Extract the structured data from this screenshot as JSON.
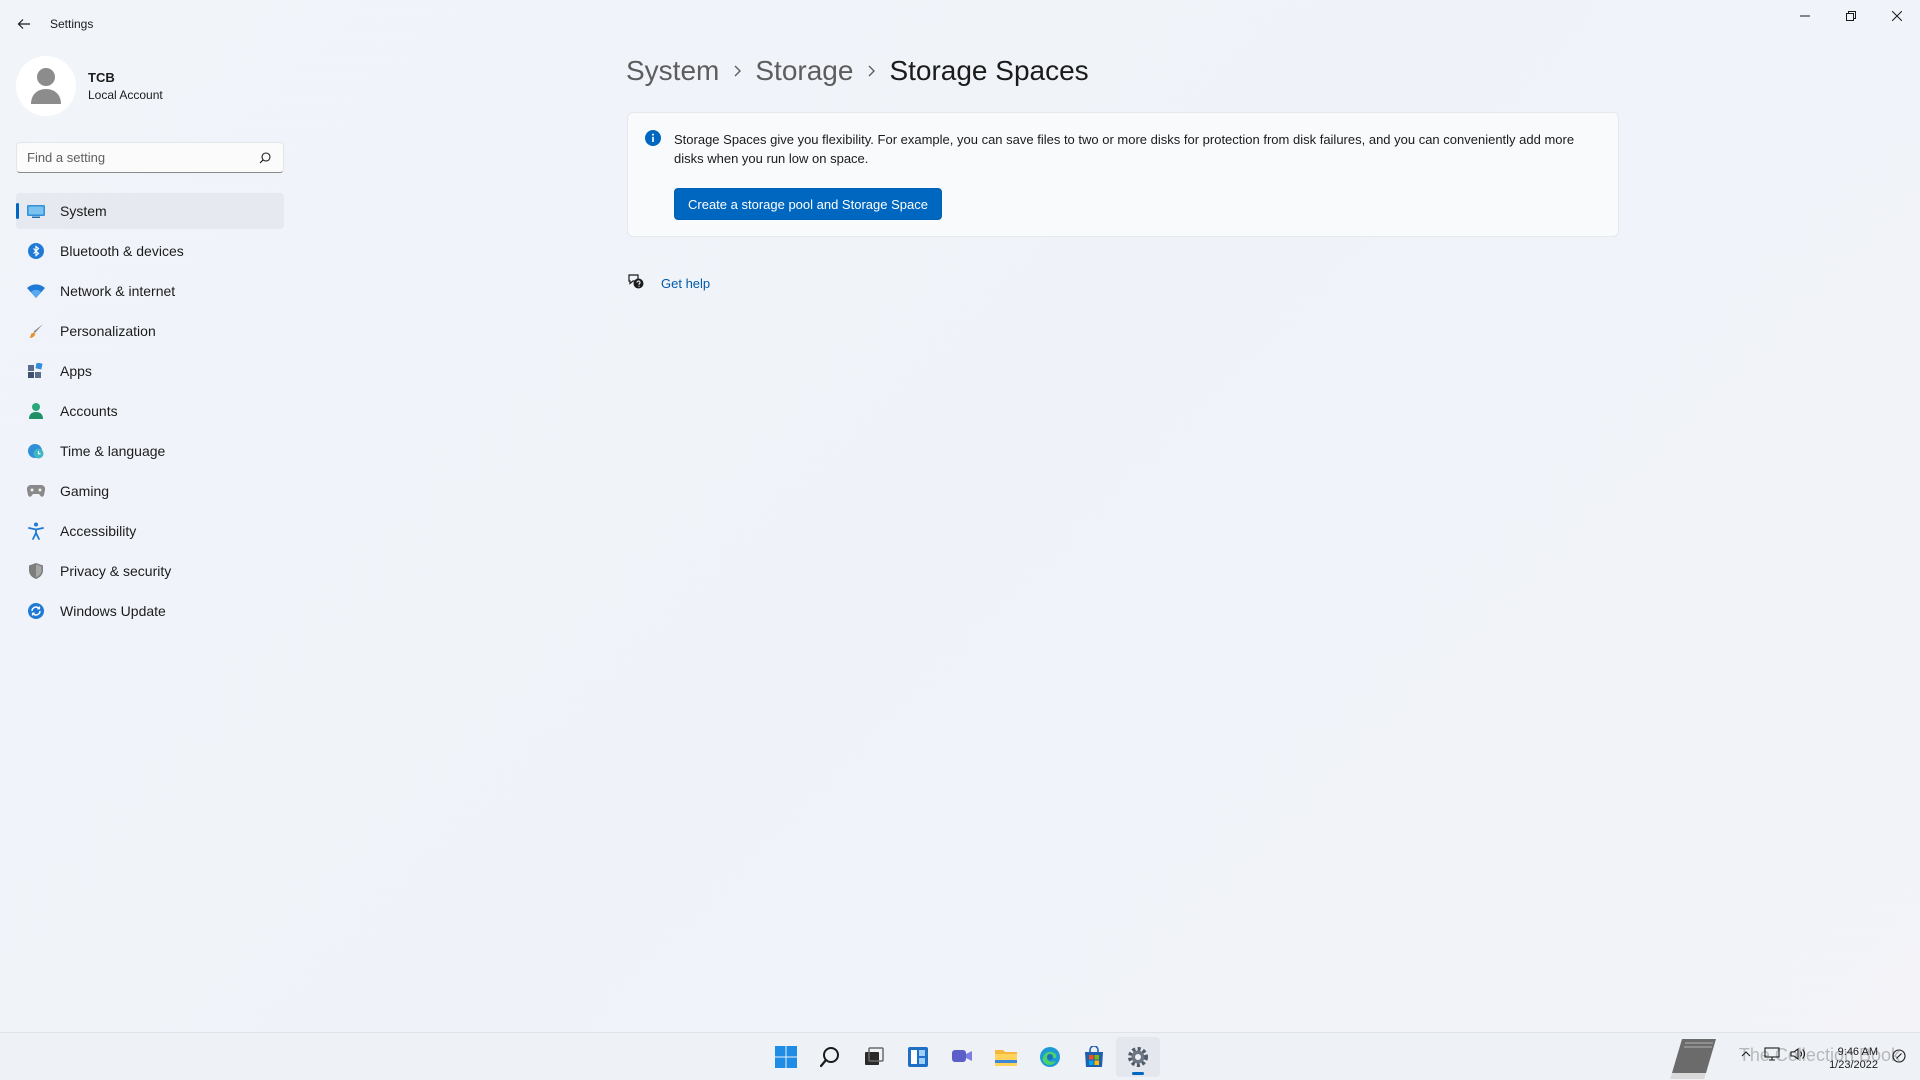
{
  "window": {
    "title": "Settings"
  },
  "profile": {
    "name": "TCB",
    "account_type": "Local Account"
  },
  "search": {
    "placeholder": "Find a setting"
  },
  "sidebar": {
    "items": [
      {
        "label": "System",
        "icon": "system-icon",
        "selected": true
      },
      {
        "label": "Bluetooth & devices",
        "icon": "bluetooth-icon"
      },
      {
        "label": "Network & internet",
        "icon": "wifi-icon"
      },
      {
        "label": "Personalization",
        "icon": "brush-icon"
      },
      {
        "label": "Apps",
        "icon": "apps-icon"
      },
      {
        "label": "Accounts",
        "icon": "account-icon"
      },
      {
        "label": "Time & language",
        "icon": "globe-clock-icon"
      },
      {
        "label": "Gaming",
        "icon": "controller-icon"
      },
      {
        "label": "Accessibility",
        "icon": "accessibility-icon"
      },
      {
        "label": "Privacy & security",
        "icon": "shield-icon"
      },
      {
        "label": "Windows Update",
        "icon": "update-icon"
      }
    ]
  },
  "breadcrumb": {
    "items": [
      "System",
      "Storage",
      "Storage Spaces"
    ]
  },
  "info_card": {
    "text": "Storage Spaces give you flexibility. For example, you can save files to two or more disks for protection from disk failures, and you can conveniently add more disks when you run low on space.",
    "button_label": "Create a storage pool and Storage Space"
  },
  "help": {
    "label": "Get help"
  },
  "taskbar": {
    "apps": [
      "start-icon",
      "search-icon",
      "task-view-icon",
      "widgets-icon",
      "chat-icon",
      "file-explorer-icon",
      "edge-icon",
      "store-icon",
      "settings-icon"
    ],
    "active_app": "settings-icon"
  },
  "tray": {
    "watermark": "The Collection Book",
    "time": "9:46 AM",
    "date": "1/23/2022"
  },
  "colors": {
    "accent": "#0067c0",
    "background": "#f1f5fa",
    "link": "#0059a9"
  }
}
